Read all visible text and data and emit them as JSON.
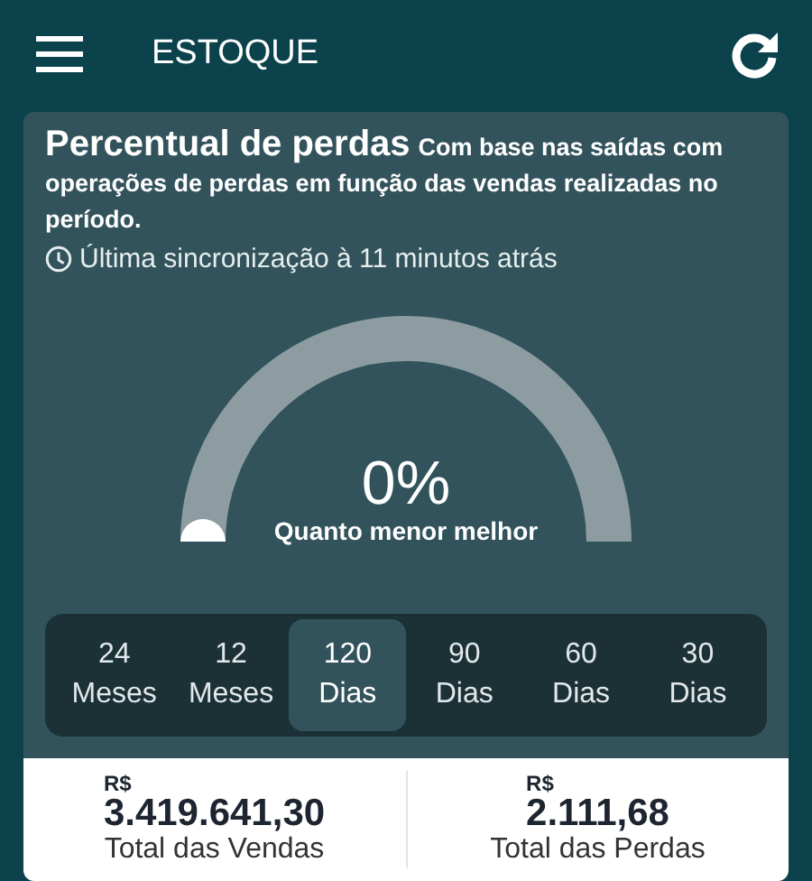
{
  "header": {
    "title": "ESTOQUE"
  },
  "card": {
    "title": "Percentual de perdas",
    "description": "Com base nas saídas com operações de perdas em função das vendas realizadas no período.",
    "sync": "Última sincronização à 11 minutos atrás",
    "gauge": {
      "value": "0%",
      "caption": "Quanto menor melhor"
    },
    "periods": [
      {
        "number": "24",
        "unit": "Meses",
        "selected": false
      },
      {
        "number": "12",
        "unit": "Meses",
        "selected": false
      },
      {
        "number": "120",
        "unit": "Dias",
        "selected": true
      },
      {
        "number": "90",
        "unit": "Dias",
        "selected": false
      },
      {
        "number": "60",
        "unit": "Dias",
        "selected": false
      },
      {
        "number": "30",
        "unit": "Dias",
        "selected": false
      }
    ],
    "totals": [
      {
        "currency": "R$",
        "amount": "3.419.641,30",
        "label": "Total das Vendas"
      },
      {
        "currency": "R$",
        "amount": "2.111,68",
        "label": "Total das Perdas"
      }
    ]
  }
}
